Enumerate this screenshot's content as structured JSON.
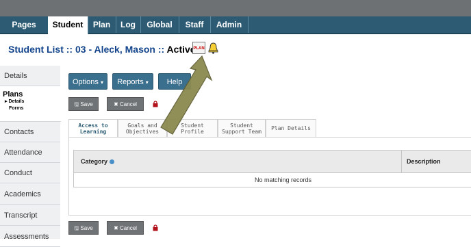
{
  "nav": {
    "tabs": [
      "Pages",
      "Student",
      "Plan",
      "Log",
      "Global",
      "Staff",
      "Admin"
    ]
  },
  "header": {
    "title_prefix": "Student List :: 03 - Aleck, Mason ::",
    "status": "Active",
    "plan_icon_text": "PLAN"
  },
  "sidebar": {
    "items": [
      "Details",
      "Contacts",
      "Attendance",
      "Conduct",
      "Academics",
      "Transcript",
      "Assessments"
    ],
    "plans": {
      "label": "Plans",
      "sub": [
        "Details",
        "Forms"
      ]
    }
  },
  "toolbar": {
    "options": "Options",
    "reports": "Reports",
    "help": "Help",
    "save": "Save",
    "cancel": "Cancel"
  },
  "subtabs": [
    {
      "line1": "Access to",
      "line2": "Learning"
    },
    {
      "line1": "Goals and",
      "line2": "Objectives"
    },
    {
      "line1": "Student",
      "line2": "Profile"
    },
    {
      "line1": "Student",
      "line2": "Support Team"
    },
    {
      "line1": "Plan Details",
      "line2": ""
    }
  ],
  "grid": {
    "col_category": "Category",
    "col_description": "Description",
    "empty_message": "No matching records"
  },
  "colors": {
    "nav_bg": "#2c5b73",
    "title": "#13448b",
    "arrow": "#8b8a50"
  }
}
